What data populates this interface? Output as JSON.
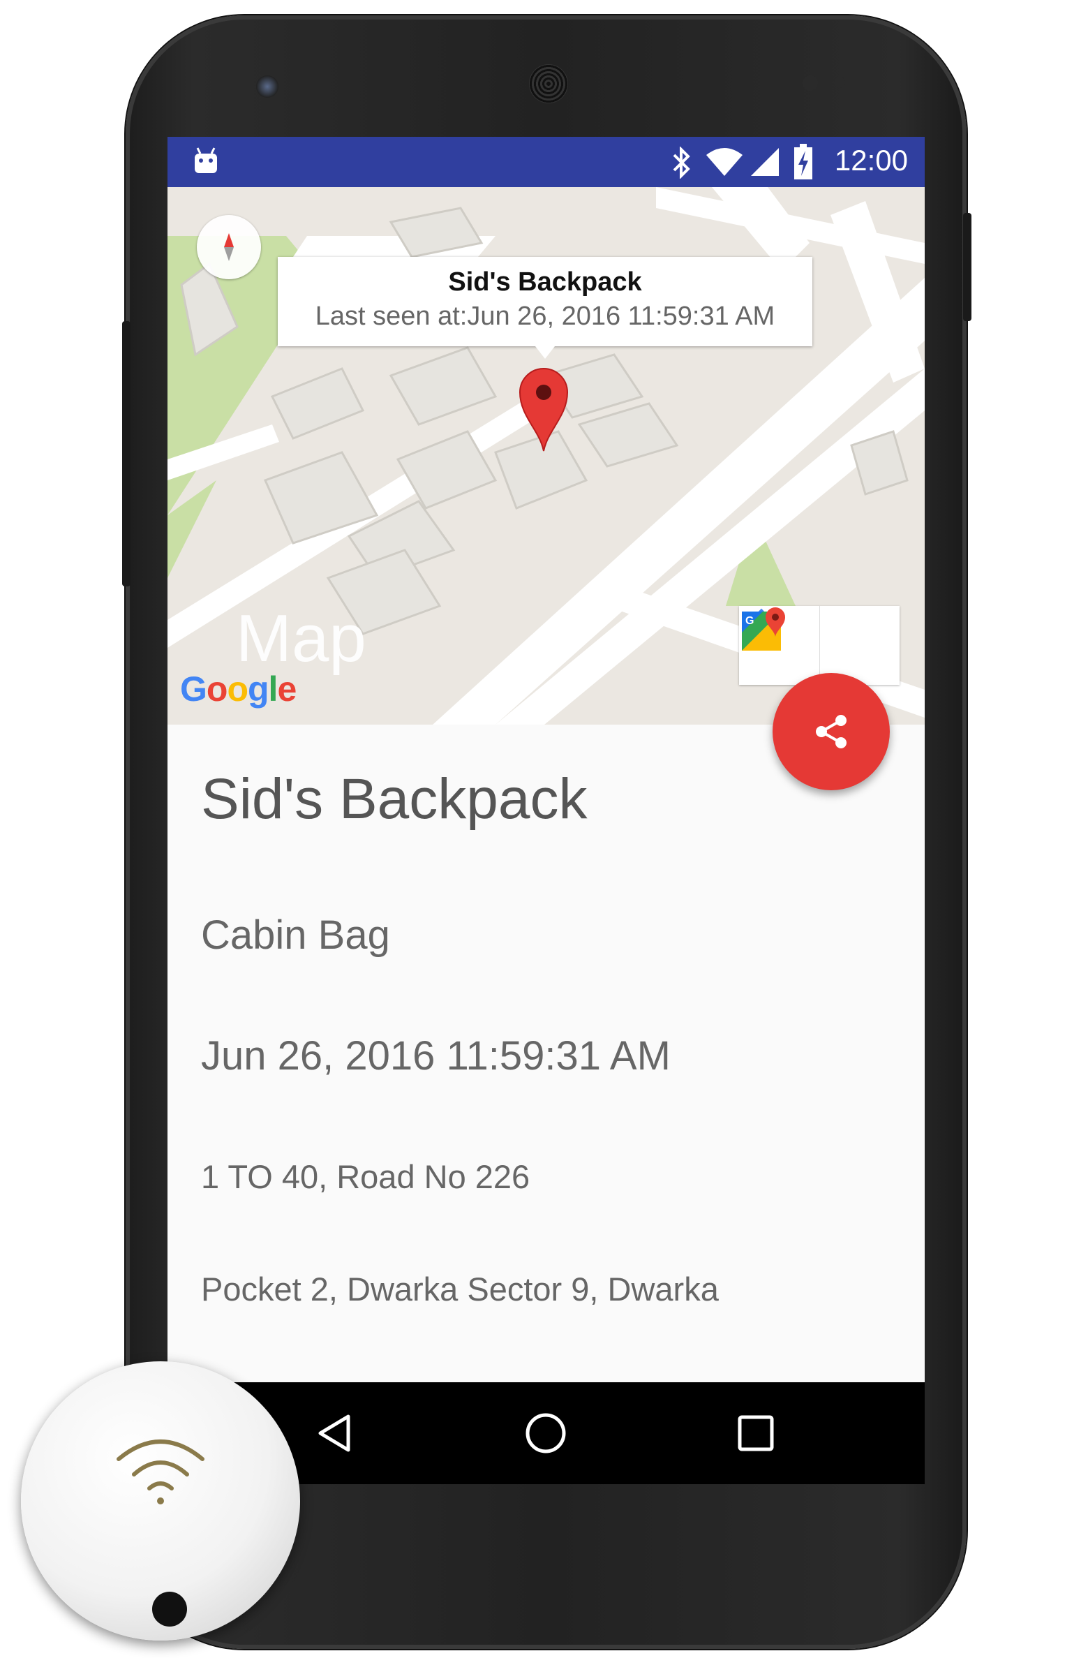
{
  "status_bar": {
    "time": "12:00",
    "icons": [
      "android-icon",
      "bluetooth-icon",
      "wifi-icon",
      "signal-icon",
      "battery-charging-icon"
    ],
    "color": "#303f9f"
  },
  "map": {
    "info_window": {
      "title": "Sid's Backpack",
      "subtitle": "Last seen at:Jun 26, 2016 11:59:31 AM"
    },
    "label": "Map",
    "attribution": "Google",
    "toolbar": [
      "directions-icon",
      "google-maps-icon"
    ],
    "marker_color": "#e53935"
  },
  "share_button": {
    "icon": "share-icon",
    "color": "#e53935"
  },
  "details": {
    "title": "Sid's Backpack",
    "type": "Cabin Bag",
    "timestamp": "Jun 26, 2016 11:59:31 AM",
    "address_line1": "1 TO 40, Road No 226",
    "address_line2": "Pocket 2, Dwarka Sector 9, Dwarka"
  },
  "nav_bar": {
    "buttons": [
      "back-icon",
      "home-icon",
      "recents-icon"
    ]
  }
}
